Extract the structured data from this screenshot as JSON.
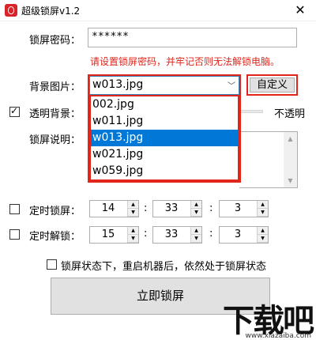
{
  "window": {
    "title": "超级锁屏v1.2",
    "close_glyph": "✕"
  },
  "password": {
    "label": "锁屏密码：",
    "value": "******",
    "hint": "请设置锁屏密码，并牢记否则无法解锁电脑。"
  },
  "background": {
    "label": "背景图片：",
    "selected": "w013.jpg",
    "options": [
      "002.jpg",
      "w011.jpg",
      "w013.jpg",
      "w021.jpg",
      "w059.jpg"
    ],
    "custom_button": "自定义"
  },
  "transparent": {
    "checked": true,
    "label": "透明背景：",
    "opaque_label": "不透明"
  },
  "description": {
    "label": "锁屏说明："
  },
  "timed_lock": {
    "checked": false,
    "label": "定时锁屏：",
    "hour": "14",
    "minute": "33",
    "second": "3"
  },
  "timed_unlock": {
    "checked": false,
    "label": "定时解锁：",
    "hour": "15",
    "minute": "33",
    "second": "3"
  },
  "persist": {
    "checked": false,
    "label": "锁屏状态下，重启机器后，依然处于锁屏状态"
  },
  "lock_now_button": "立即锁屏",
  "colon": ":",
  "watermark": {
    "main": "下载吧",
    "sub": "www.xiazaiba.com"
  },
  "colors": {
    "accent_red": "#e1251b",
    "selection_blue": "#0078d7"
  }
}
